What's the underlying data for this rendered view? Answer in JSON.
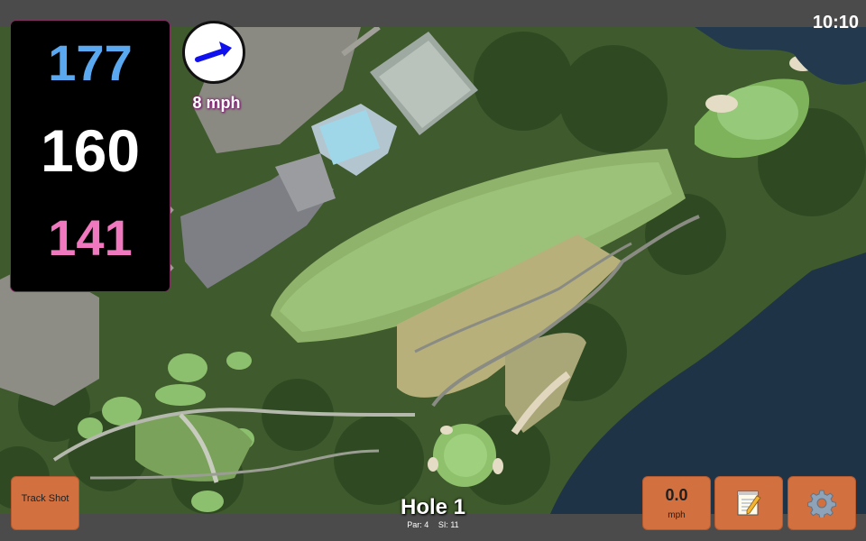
{
  "status": {
    "time": "10:10"
  },
  "distances": {
    "back": "177",
    "middle": "160",
    "front": "141"
  },
  "wind": {
    "speed_label": "8 mph",
    "arrow_icon": "wind-arrow-icon",
    "arrow_color": "#1010ee"
  },
  "hole": {
    "title": "Hole 1",
    "par_label": "Par: 4",
    "si_label": "SI: 11"
  },
  "buttons": {
    "track_shot": "Track Shot",
    "speed_value": "0.0",
    "speed_unit": "mph",
    "notes_icon": "notepad-icon",
    "settings_icon": "gear-icon"
  },
  "colors": {
    "back_distance": "#5aa9f0",
    "middle_distance": "#ffffff",
    "front_distance": "#f078bf",
    "button": "#d2703f"
  }
}
